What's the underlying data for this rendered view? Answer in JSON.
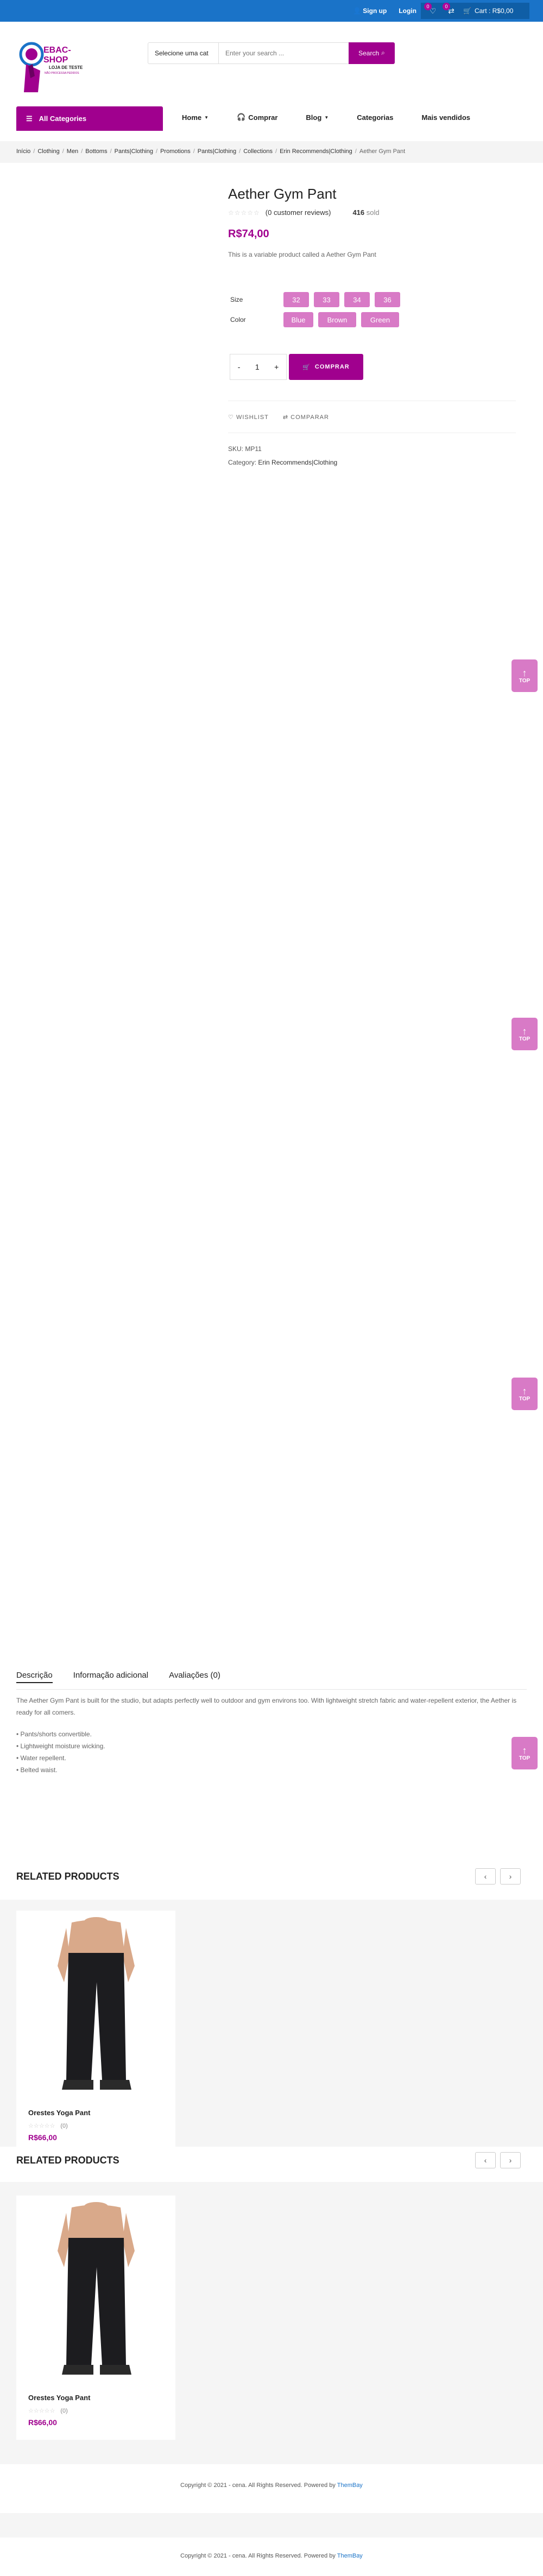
{
  "topbar": {
    "signup": "Sign up",
    "login": "Login",
    "wishlist_count": "0",
    "compare_count": "0",
    "cart_label": "Cart : R$0,00"
  },
  "brand": {
    "name": "EBAC-SHOP",
    "tagline1": "LOJA DE TESTE",
    "tagline2": "NÃO PROCESSA PEDIDOS",
    "accent": "#a0008e",
    "blue": "#1a73c8"
  },
  "search": {
    "category": "Selecione uma cat",
    "placeholder": "Enter your search ...",
    "button": "Search"
  },
  "nav": {
    "all_categories": "All Categories",
    "items": [
      "Home",
      "Comprar",
      "Blog",
      "Categorias",
      "Mais vendidos"
    ]
  },
  "breadcrumb": [
    "Início",
    "Clothing",
    "Men",
    "Bottoms",
    "Pants|Clothing",
    "Promotions",
    "Pants|Clothing",
    "Collections",
    "Erin Recommends|Clothing",
    "Aether Gym Pant"
  ],
  "product": {
    "title": "Aether Gym Pant",
    "reviews": "(0 customer reviews)",
    "sold_count": "416",
    "sold_label": "sold",
    "price": "R$74,00",
    "short_description": "This is a variable product called a Aether Gym Pant",
    "size_label": "Size",
    "sizes": [
      "32",
      "33",
      "34",
      "36"
    ],
    "color_label": "Color",
    "colors": [
      "Blue",
      "Brown",
      "Green"
    ],
    "qty": "1",
    "qty_minus": "-",
    "qty_plus": "+",
    "buy_button": "COMPRAR",
    "wishlist": "WISHLIST",
    "compare": "COMPARAR",
    "sku_label": "SKU:",
    "sku": "MP11",
    "category_label": "Category:",
    "category": "Erin Recommends|Clothing"
  },
  "top_button": "TOP",
  "tabs": {
    "items": [
      "Descrição",
      "Informação adicional",
      "Avaliações (0)"
    ],
    "description": "The Aether Gym Pant is built for the studio, but adapts perfectly well to outdoor and gym environs too. With lightweight stretch fabric and water-repellent exterior, the Aether is ready for all comers.",
    "features": [
      "• Pants/shorts convertible.",
      "• Lightweight moisture wicking.",
      "• Water repellent.",
      "• Belted waist."
    ]
  },
  "related": {
    "title": "RELATED PRODUCTS",
    "prev": "‹",
    "next": "›",
    "product_name": "Orestes Yoga Pant",
    "product_reviews": "(0)",
    "product_price": "R$66,00"
  },
  "footer": {
    "copyright": "Copyright © 2021 - cena. All Rights Reserved. Powered by",
    "powered": "ThemBay"
  }
}
